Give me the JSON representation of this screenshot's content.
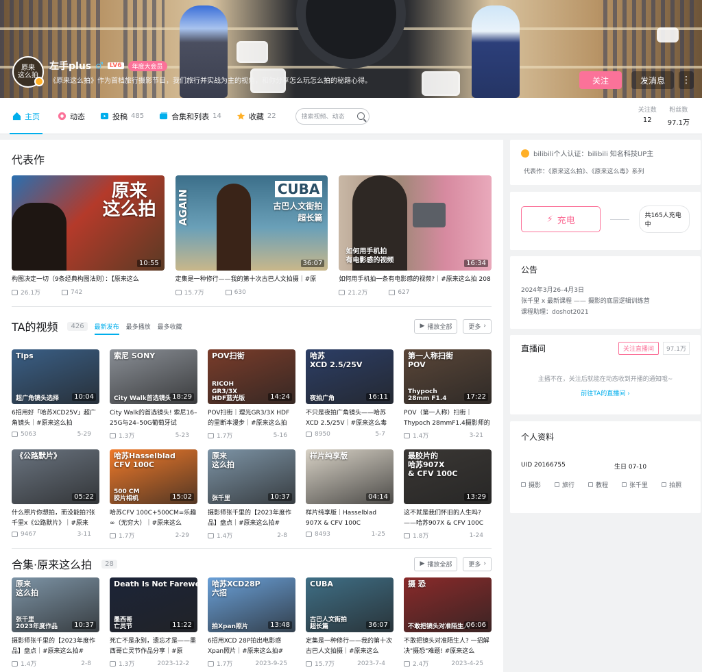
{
  "profile": {
    "name": "左手plus",
    "gender_symbol": "♂",
    "level": "LV6",
    "vip": "年度大会员",
    "avatar_text": "原来\n这么拍",
    "sign": "《原来这么拍》作为首档旅行摄影节目，我们旅行并实战为主的视角，和你分享怎么玩怎么拍的秘籍心得。",
    "follow_label": "关注",
    "message_label": "发消息",
    "more_label": "⋮"
  },
  "nav": {
    "items": [
      {
        "label": "主页",
        "count": "",
        "icon": "home-icon"
      },
      {
        "label": "动态",
        "count": "",
        "icon": "dynamic-icon"
      },
      {
        "label": "投稿",
        "count": "485",
        "icon": "upload-icon"
      },
      {
        "label": "合集和列表",
        "count": "14",
        "icon": "collection-icon"
      },
      {
        "label": "收藏",
        "count": "22",
        "icon": "star-icon"
      }
    ],
    "search_placeholder": "搜索视频、动态",
    "stats": [
      {
        "label": "关注数",
        "value": "12"
      },
      {
        "label": "粉丝数",
        "value": "97.1万"
      }
    ]
  },
  "featured": {
    "title": "代表作",
    "videos": [
      {
        "overlay": "原来\n这么拍",
        "duration": "10:55",
        "title": "构图决定一切（9条经典构图法则）：【原来这么",
        "views": "26.1万",
        "danmaku": "742"
      },
      {
        "overlay": "CUBA",
        "overlay2": "古巴人文街拍\n超长篇",
        "side": "AGAIN",
        "duration": "36:07",
        "title": "定集是一种修行——我的第十次古巴人文拍摄｜#原",
        "views": "15.7万",
        "danmaku": "630"
      },
      {
        "overlay": "如何用手机拍\n有电影感的视频",
        "duration": "16:34",
        "title": "如何用手机拍一条有电影感的视频?｜#原来这么拍 208",
        "views": "21.2万",
        "danmaku": "627"
      }
    ]
  },
  "videos": {
    "title": "TA的视频",
    "count": "426",
    "tabs": [
      "最新发布",
      "最多播放",
      "最多收藏"
    ],
    "play_all": "播放全部",
    "more": "更多",
    "items": [
      {
        "overlay": "Tips",
        "overlay2": "超广角镜头选择",
        "duration": "10:04",
        "title": "6招用好「哈苏XCD25V」超广角镜头｜#原来这么拍",
        "views": "5063",
        "date": "5-29",
        "bg": "#3a5f86"
      },
      {
        "overlay": "索尼 SONY",
        "overlay2": "City Walk首选镜头",
        "duration": "18:29",
        "title": "City Walk的首选镜头! 索尼16–25G与24–50G葡萄牙试",
        "views": "1.3万",
        "date": "5-23",
        "bg": "#8a8f96"
      },
      {
        "overlay": "POV扫街",
        "overlay2": "RICOH\nGR3/3X\nHDF蓝光版",
        "duration": "14:24",
        "title": "POV扫街｜理光GR3/3X HDF的里断本漫步｜#原来这么拍",
        "views": "1.7万",
        "date": "5-16",
        "bg": "#7a3c2a"
      },
      {
        "overlay": "哈苏\nXCD 2.5/25V",
        "overlay2": "夜拍广角",
        "duration": "16:11",
        "title": "不只是夜拍广角镜头——哈苏XCD 2.5/25V｜#原来这么毒",
        "views": "8950",
        "date": "5-7",
        "bg": "#2c3e66"
      },
      {
        "overlay": "第一人称扫街\nPOV",
        "overlay2": "Thypoch\n28mm F1.4",
        "duration": "17:22",
        "title": "POV（第一人称）扫街｜Thypoch 28mmF1.4摄影师的",
        "views": "1.4万",
        "date": "3-21",
        "bg": "#5a4638"
      },
      {
        "overlay": "《公路默片》",
        "overlay2": "",
        "duration": "05:22",
        "title": "什么照片你想拍，而没能拍?张千里x《公路默片》｜#原来",
        "views": "9467",
        "date": "3-11",
        "bg": "#6a7480"
      },
      {
        "overlay": "哈苏Hasselblad\nCFV 100C",
        "overlay2": "500 CM\n胶片相机",
        "duration": "15:02",
        "title": "哈苏CFV 100C+500CM=乐趣∞（无穷大）｜#原来这么",
        "views": "1.7万",
        "date": "2-29",
        "bg": "#f07a2a"
      },
      {
        "overlay": "原来\n这么拍",
        "overlay2": "张千里",
        "duration": "10:37",
        "title": "摄影师张千里的【2023年度作品】盘点｜#原来这么拍#",
        "views": "1.4万",
        "date": "2-8",
        "bg": "#7d94a6"
      },
      {
        "overlay": "样片纯享版",
        "overlay2": "",
        "duration": "04:14",
        "title": "样片纯享版｜Hasselblad 907X & CFV 100C",
        "views": "8493",
        "date": "1-25",
        "bg": "#d8d2c6"
      },
      {
        "overlay": "最胶片的\n哈苏907X\n& CFV 100C",
        "overlay2": "",
        "duration": "13:29",
        "title": "这不就是我们怀旧的人生吗?——哈苏907X & CFV 100C",
        "views": "1.8万",
        "date": "1-24",
        "bg": "#3a3734"
      }
    ]
  },
  "collection": {
    "title": "合集·原来这么拍",
    "count": "28",
    "play_all": "播放全部",
    "more": "更多",
    "items": [
      {
        "overlay": "原来\n这么拍",
        "overlay2": "张千里\n2023年度作品",
        "duration": "10:37",
        "title": "摄影师张千里的【2023年度作品】盘点｜#原来这么拍#",
        "views": "1.4万",
        "date": "2-8",
        "bg": "#7d94a6"
      },
      {
        "overlay": "Death Is Not Farewell",
        "overlay2": "墨西哥\n亡灵节",
        "duration": "11:22",
        "title": "死亡不是永别，遗忘才是——墨西哥亡灵节作品分享｜#原",
        "views": "1.3万",
        "date": "2023-12-2",
        "bg": "#1c2438"
      },
      {
        "overlay": "哈苏XCD28P\n六招",
        "overlay2": "拍Xpan照片",
        "duration": "13:48",
        "title": "6招用XCD 28P拍出电影感Xpan照片｜#原来这么拍#",
        "views": "1.7万",
        "date": "2023-9-25",
        "bg": "#6aa0d8"
      },
      {
        "overlay": "CUBA",
        "overlay2": "古巴人文街拍\n超长篇",
        "duration": "36:07",
        "title": "定集是一种修行——我的第十次古巴人文拍摄｜#原来这么",
        "views": "15.7万",
        "date": "2023-7-4",
        "bg": "#3f6f86"
      },
      {
        "overlay": "摄 恐",
        "overlay2": "不敢把镜头对准陌生人",
        "duration": "06:06",
        "title": "不敢把镜头对准陌生人? 一招解决\"摄恐\"难题! #原来这么",
        "views": "2.4万",
        "date": "2023-4-25",
        "bg": "#8a2a2a"
      }
    ]
  },
  "sidebar": {
    "cert_label": "bilibili个人认证：bilibili 知名科技UP主",
    "rep_label": "代表作：《原来这么拍》、《原来这么毒》系列",
    "charge_label": "充电",
    "charge_count": "共165人充电中",
    "notice_title": "公告",
    "notice_lines": [
      "2024年3月26–4月3日",
      "张千里 x 最新课程 —— 摄影的底层逻辑训练营",
      "课程助理：doshot2021"
    ],
    "live_title": "直播间",
    "live_follow": "关注直播间",
    "live_fans": "97.1万",
    "live_msg": "主播不在，关注后就能在动态收到开播的通知哦~",
    "live_link": "前往TA的直播间 ›",
    "info_title": "个人资料",
    "uid_label": "UID",
    "uid": "20166755",
    "birthday_label": "生日",
    "birthday": "07-10",
    "tags": [
      "摄影",
      "旅行",
      "教程",
      "张千里",
      "拍照"
    ]
  },
  "colors": {
    "accent": "#00aeec",
    "pink": "#fb7299"
  }
}
